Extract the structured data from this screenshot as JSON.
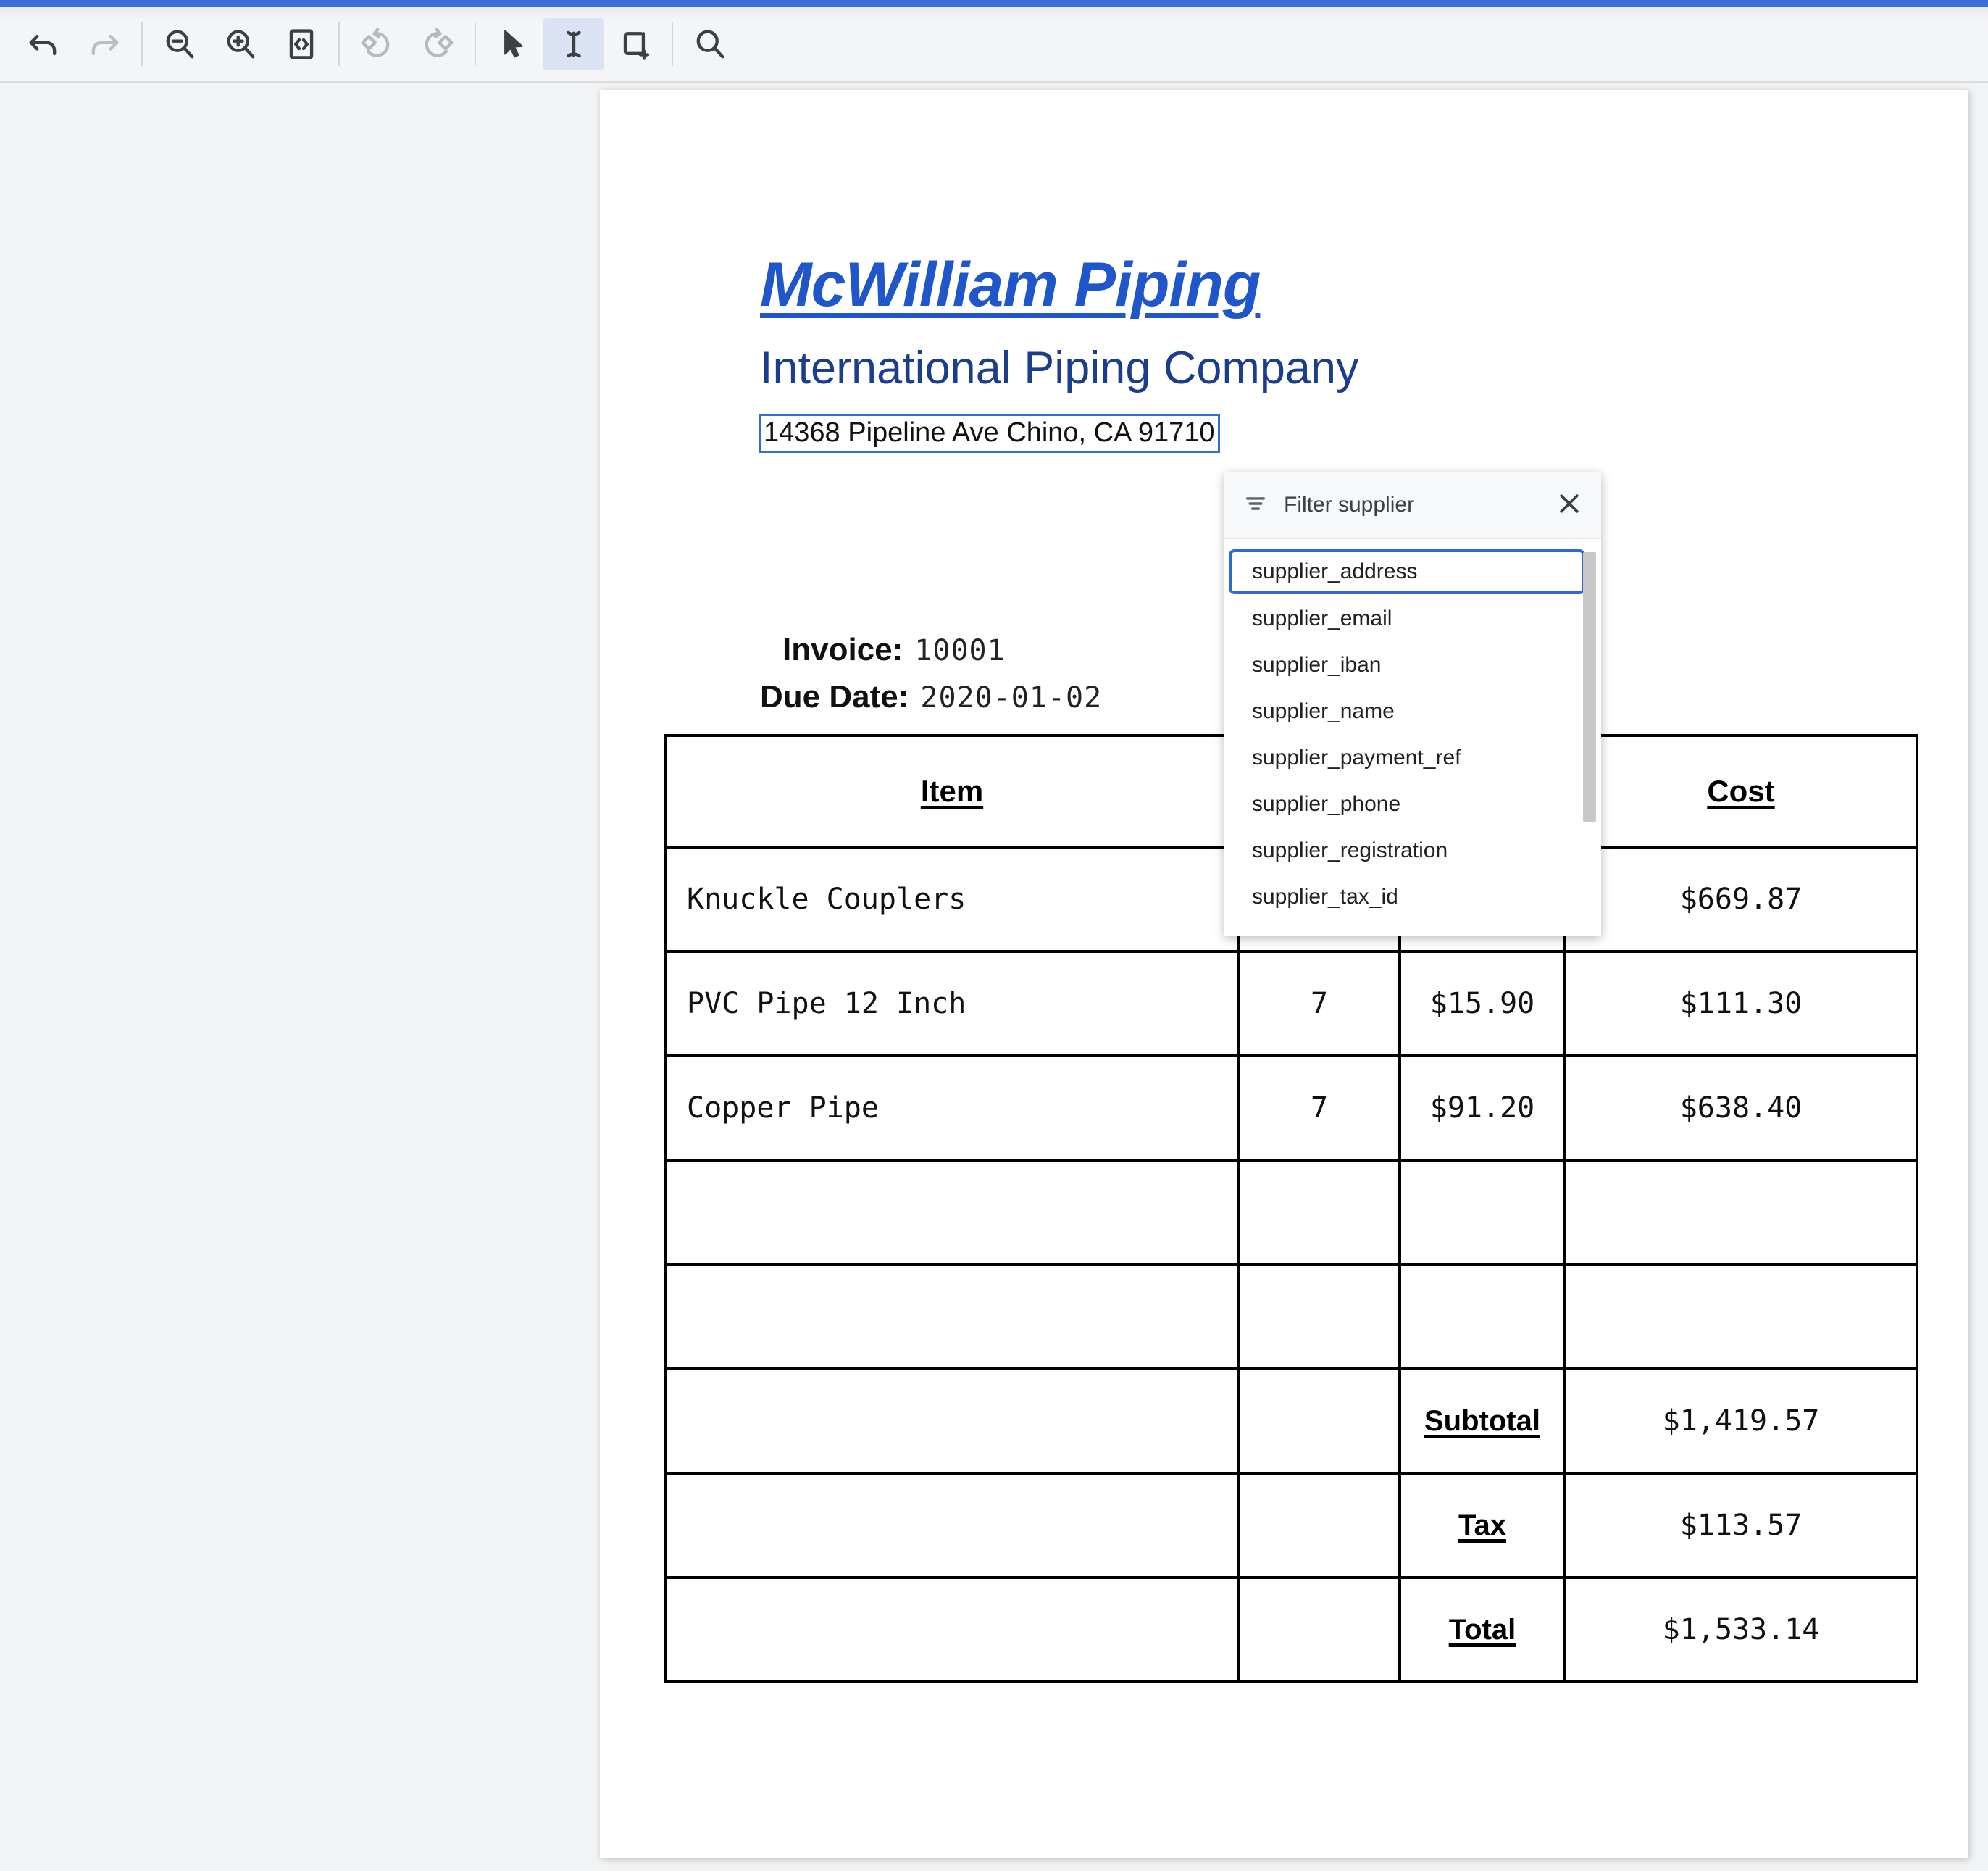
{
  "toolbar": {
    "buttons": [
      {
        "name": "undo-icon",
        "label": "Undo",
        "state": "enabled"
      },
      {
        "name": "redo-icon",
        "label": "Redo",
        "state": "disabled"
      },
      {
        "name": "zoom-out-icon",
        "label": "Zoom out",
        "state": "enabled"
      },
      {
        "name": "zoom-in-icon",
        "label": "Zoom in",
        "state": "enabled"
      },
      {
        "name": "fit-width-icon",
        "label": "Fit to width",
        "state": "enabled"
      },
      {
        "name": "rotate-left-icon",
        "label": "Rotate left",
        "state": "disabled"
      },
      {
        "name": "rotate-right-icon",
        "label": "Rotate right",
        "state": "disabled"
      },
      {
        "name": "pointer-tool-icon",
        "label": "Select",
        "state": "enabled"
      },
      {
        "name": "text-select-tool-icon",
        "label": "Text select",
        "state": "active"
      },
      {
        "name": "add-region-tool-icon",
        "label": "Add region",
        "state": "enabled"
      },
      {
        "name": "search-icon",
        "label": "Search",
        "state": "enabled"
      }
    ],
    "accent_color": "#3a6fd8",
    "active_tool_bg": "#dbe2f4"
  },
  "document": {
    "company_name": "McWilliam Piping",
    "company_subtitle": "International Piping Company",
    "company_address": "14368 Pipeline Ave Chino, CA 91710",
    "address_highlight_color": "#2f6ddb",
    "title_color": "#1f56c9",
    "subtitle_color": "#1b3e8c",
    "invoice_label": "Invoice:",
    "invoice_number": "10001",
    "due_date_label": "Due Date:",
    "due_date_value": "2020-01-02"
  },
  "table": {
    "headers": {
      "item": "Item",
      "quantity": "",
      "price": "",
      "cost": "Cost"
    },
    "rows": [
      {
        "item": "Knuckle Couplers",
        "quantity": "",
        "price": "",
        "cost": "$669.87"
      },
      {
        "item": "PVC Pipe 12 Inch",
        "quantity": "7",
        "price": "$15.90",
        "cost": "$111.30"
      },
      {
        "item": "Copper Pipe",
        "quantity": "7",
        "price": "$91.20",
        "cost": "$638.40"
      },
      {
        "item": "",
        "quantity": "",
        "price": "",
        "cost": ""
      },
      {
        "item": "",
        "quantity": "",
        "price": "",
        "cost": ""
      }
    ],
    "totals": [
      {
        "label": "Subtotal",
        "value": "$1,419.57"
      },
      {
        "label": "Tax",
        "value": "$113.57"
      },
      {
        "label": "Total",
        "value": "$1,533.14"
      }
    ]
  },
  "filter_panel": {
    "title": "Filter supplier",
    "close_label": "Close",
    "selected_item": "supplier_address",
    "selection_color": "#3367d6",
    "items": [
      "supplier_address",
      "supplier_email",
      "supplier_iban",
      "supplier_name",
      "supplier_payment_ref",
      "supplier_phone",
      "supplier_registration",
      "supplier_tax_id"
    ]
  }
}
